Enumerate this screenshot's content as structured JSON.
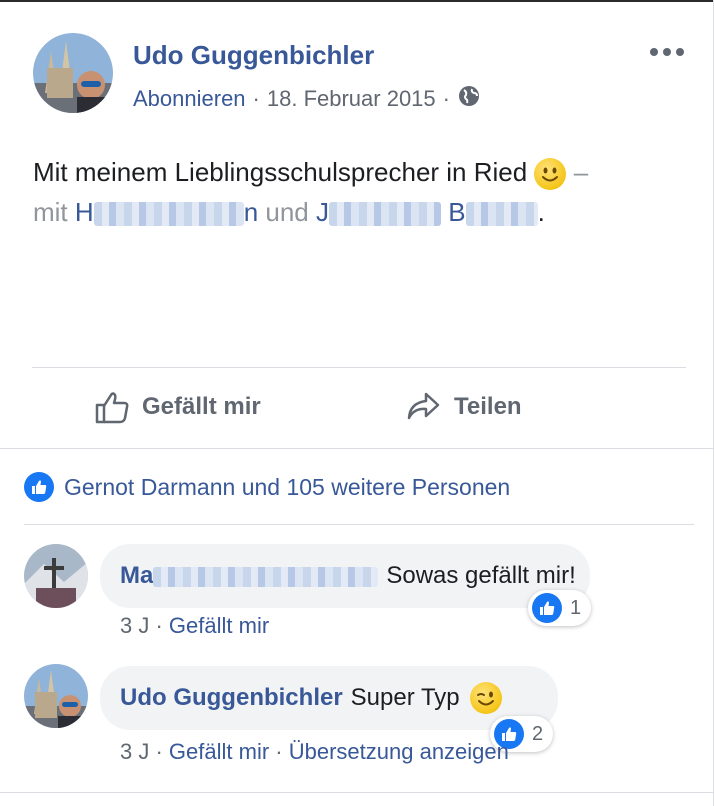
{
  "post": {
    "author": "Udo Guggenbichler",
    "follow_label": "Abonnieren",
    "date": "18. Februar 2015",
    "text_main": "Mit meinem Lieblingsschulsprecher in Ried",
    "text_dash": "–",
    "text_with": "mit",
    "tag1_start": "H",
    "tag1_end": "n",
    "text_and": "und",
    "tag2_start": "J",
    "tag2_mid": "B",
    "text_period": "."
  },
  "actions": {
    "like": "Gefällt mir",
    "share": "Teilen"
  },
  "likes_summary": "Gernot Darmann und 105 weitere Personen",
  "comments": [
    {
      "name_start": "Ma",
      "text": "Sowas gefällt mir!",
      "reaction_count": "1",
      "age": "3 J",
      "like_label": "Gefällt mir"
    },
    {
      "name": "Udo Guggenbichler",
      "text": "Super Typ",
      "reaction_count": "2",
      "age": "3 J",
      "like_label": "Gefällt mir",
      "translate_label": "Übersetzung anzeigen"
    }
  ],
  "icons": {
    "more": "more-options-icon",
    "globe": "globe-icon",
    "like": "thumbs-up-icon",
    "share": "share-arrow-icon"
  },
  "colors": {
    "link": "#385898",
    "meta": "#606770",
    "like_blue": "#1877f2",
    "bubble": "#f2f3f5"
  }
}
